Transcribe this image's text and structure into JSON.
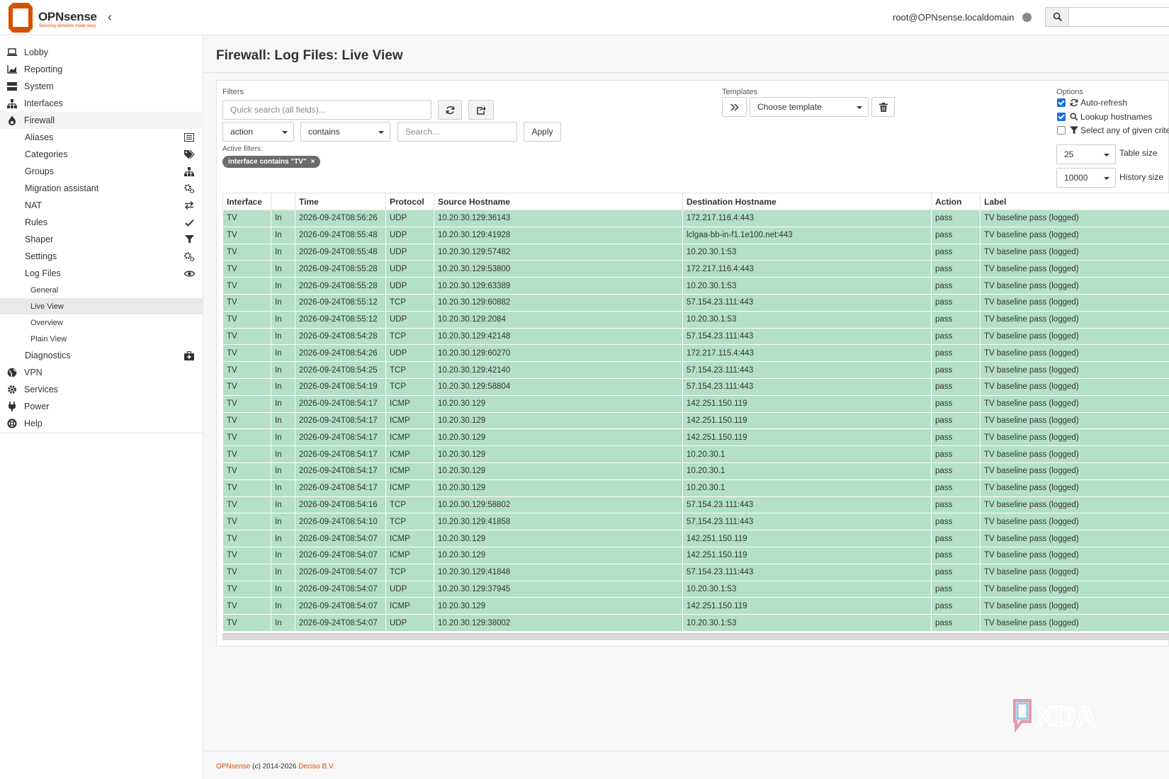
{
  "header": {
    "brand": "OPNsense",
    "tagline": "Securing networks made easy",
    "user": "root@OPNsense.localdomain"
  },
  "sidebar": {
    "top_items": [
      {
        "label": "Lobby",
        "icon": "laptop-icon"
      },
      {
        "label": "Reporting",
        "icon": "chart-icon"
      },
      {
        "label": "System",
        "icon": "server-icon"
      },
      {
        "label": "Interfaces",
        "icon": "sitemap-icon"
      },
      {
        "label": "Firewall",
        "icon": "fire-icon"
      }
    ],
    "firewall_items": [
      {
        "label": "Aliases",
        "icon": "list-icon"
      },
      {
        "label": "Categories",
        "icon": "tags-icon"
      },
      {
        "label": "Groups",
        "icon": "sitemap-icon"
      },
      {
        "label": "Migration assistant",
        "icon": "cogs-icon"
      },
      {
        "label": "NAT",
        "icon": "exchange-icon"
      },
      {
        "label": "Rules",
        "icon": "check-icon"
      },
      {
        "label": "Shaper",
        "icon": "filter-icon"
      },
      {
        "label": "Settings",
        "icon": "cogs-icon"
      },
      {
        "label": "Log Files",
        "icon": "eye-icon"
      }
    ],
    "log_items": [
      "General",
      "Live View",
      "Overview",
      "Plain View"
    ],
    "diagnostics": {
      "label": "Diagnostics",
      "icon": "medkit-icon"
    },
    "bottom_items": [
      {
        "label": "VPN",
        "icon": "globe-icon"
      },
      {
        "label": "Services",
        "icon": "cog-icon"
      },
      {
        "label": "Power",
        "icon": "plug-icon"
      },
      {
        "label": "Help",
        "icon": "lifebuoy-icon"
      }
    ]
  },
  "page": {
    "title": "Firewall: Log Files: Live View"
  },
  "filters": {
    "label": "Filters",
    "quick_search_placeholder": "Quick search (all fields)...",
    "field_select": "action",
    "operator_select": "contains",
    "value_placeholder": "Search...",
    "apply_label": "Apply",
    "active_label": "Active filters:",
    "active_chip": "interface contains \"TV\"",
    "chip_close": "×"
  },
  "templates": {
    "label": "Templates",
    "select": "Choose template"
  },
  "options": {
    "label": "Options",
    "auto_refresh": "Auto-refresh",
    "lookup_hostnames": "Lookup hostnames",
    "select_any": "Select any of given criteria",
    "table_size_value": "25",
    "table_size_label": "Table size",
    "history_size_value": "10000",
    "history_size_label": "History size"
  },
  "table": {
    "columns": [
      "Interface",
      "",
      "Time",
      "Protocol",
      "Source Hostname",
      "Destination Hostname",
      "Action",
      "Label"
    ],
    "rows": [
      [
        "TV",
        "In",
        "2026-09-24T08:56:26",
        "UDP",
        "10.20.30.129:36143",
        "172.217.116.4:443",
        "pass",
        "TV baseline pass (logged)"
      ],
      [
        "TV",
        "In",
        "2026-09-24T08:55:48",
        "UDP",
        "10.20.30.129:41928",
        "lclgaa-bb-in-f1.1e100.net:443",
        "pass",
        "TV baseline pass (logged)"
      ],
      [
        "TV",
        "In",
        "2026-09-24T08:55:48",
        "UDP",
        "10.20.30.129:57482",
        "10.20.30.1:53",
        "pass",
        "TV baseline pass (logged)"
      ],
      [
        "TV",
        "In",
        "2026-09-24T08:55:28",
        "UDP",
        "10.20.30.129:53800",
        "172.217.116.4:443",
        "pass",
        "TV baseline pass (logged)"
      ],
      [
        "TV",
        "In",
        "2026-09-24T08:55:28",
        "UDP",
        "10.20.30.129:63389",
        "10.20.30.1:53",
        "pass",
        "TV baseline pass (logged)"
      ],
      [
        "TV",
        "In",
        "2026-09-24T08:55:12",
        "TCP",
        "10.20.30.129:60882",
        "57.154.23.111:443",
        "pass",
        "TV baseline pass (logged)"
      ],
      [
        "TV",
        "In",
        "2026-09-24T08:55:12",
        "UDP",
        "10.20.30.129:2084",
        "10.20.30.1:53",
        "pass",
        "TV baseline pass (logged)"
      ],
      [
        "TV",
        "In",
        "2026-09-24T08:54:28",
        "TCP",
        "10.20.30.129:42148",
        "57.154.23.111:443",
        "pass",
        "TV baseline pass (logged)"
      ],
      [
        "TV",
        "In",
        "2026-09-24T08:54:26",
        "UDP",
        "10.20.30.129:60270",
        "172.217.115.4:443",
        "pass",
        "TV baseline pass (logged)"
      ],
      [
        "TV",
        "In",
        "2026-09-24T08:54:25",
        "TCP",
        "10.20.30.129:42140",
        "57.154.23.111:443",
        "pass",
        "TV baseline pass (logged)"
      ],
      [
        "TV",
        "In",
        "2026-09-24T08:54:19",
        "TCP",
        "10.20.30.129:58804",
        "57.154.23.111:443",
        "pass",
        "TV baseline pass (logged)"
      ],
      [
        "TV",
        "In",
        "2026-09-24T08:54:17",
        "ICMP",
        "10.20.30.129",
        "142.251.150.119",
        "pass",
        "TV baseline pass (logged)"
      ],
      [
        "TV",
        "In",
        "2026-09-24T08:54:17",
        "ICMP",
        "10.20.30.129",
        "142.251.150.119",
        "pass",
        "TV baseline pass (logged)"
      ],
      [
        "TV",
        "In",
        "2026-09-24T08:54:17",
        "ICMP",
        "10.20.30.129",
        "142.251.150.119",
        "pass",
        "TV baseline pass (logged)"
      ],
      [
        "TV",
        "In",
        "2026-09-24T08:54:17",
        "ICMP",
        "10.20.30.129",
        "10.20.30.1",
        "pass",
        "TV baseline pass (logged)"
      ],
      [
        "TV",
        "In",
        "2026-09-24T08:54:17",
        "ICMP",
        "10.20.30.129",
        "10.20.30.1",
        "pass",
        "TV baseline pass (logged)"
      ],
      [
        "TV",
        "In",
        "2026-09-24T08:54:17",
        "ICMP",
        "10.20.30.129",
        "10.20.30.1",
        "pass",
        "TV baseline pass (logged)"
      ],
      [
        "TV",
        "In",
        "2026-09-24T08:54:16",
        "TCP",
        "10.20.30.129:58802",
        "57.154.23.111:443",
        "pass",
        "TV baseline pass (logged)"
      ],
      [
        "TV",
        "In",
        "2026-09-24T08:54:10",
        "TCP",
        "10.20.30.129:41858",
        "57.154.23.111:443",
        "pass",
        "TV baseline pass (logged)"
      ],
      [
        "TV",
        "In",
        "2026-09-24T08:54:07",
        "ICMP",
        "10.20.30.129",
        "142.251.150.119",
        "pass",
        "TV baseline pass (logged)"
      ],
      [
        "TV",
        "In",
        "2026-09-24T08:54:07",
        "ICMP",
        "10.20.30.129",
        "142.251.150.119",
        "pass",
        "TV baseline pass (logged)"
      ],
      [
        "TV",
        "In",
        "2026-09-24T08:54:07",
        "TCP",
        "10.20.30.129:41848",
        "57.154.23.111:443",
        "pass",
        "TV baseline pass (logged)"
      ],
      [
        "TV",
        "In",
        "2026-09-24T08:54:07",
        "UDP",
        "10.20.30.129:37945",
        "10.20.30.1:53",
        "pass",
        "TV baseline pass (logged)"
      ],
      [
        "TV",
        "In",
        "2026-09-24T08:54:07",
        "ICMP",
        "10.20.30.129",
        "142.251.150.119",
        "pass",
        "TV baseline pass (logged)"
      ],
      [
        "TV",
        "In",
        "2026-09-24T08:54:07",
        "UDP",
        "10.20.30.129:38002",
        "10.20.30.1:53",
        "pass",
        "TV baseline pass (logged)"
      ]
    ]
  },
  "footer": {
    "brand": "OPNsense",
    "copyright": " (c) 2014-2026 ",
    "company": "Deciso B.V."
  },
  "watermark": "XDA",
  "colors": {
    "accent": "#d94f00",
    "pass_row": "#b4dfc8"
  }
}
